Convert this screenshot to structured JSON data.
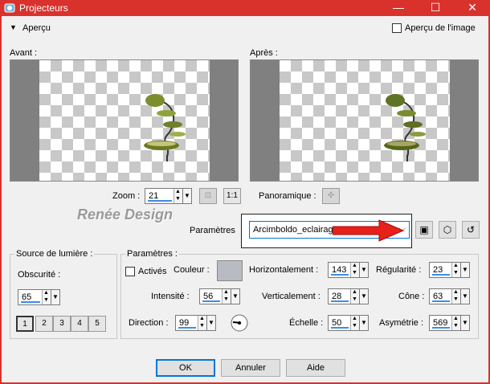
{
  "window": {
    "title": "Projecteurs",
    "minimize": "—",
    "maximize": "☐",
    "close": "✕"
  },
  "preview_header": {
    "toggle": "▼",
    "label": "Aperçu",
    "image_preview_label": "Aperçu de l'image"
  },
  "before": {
    "label": "Avant :"
  },
  "after": {
    "label": "Après :"
  },
  "zoom": {
    "label": "Zoom :",
    "value": "21"
  },
  "pan": {
    "label": "Panoramique :"
  },
  "watermark": "Renée Design",
  "presets": {
    "label": "Paramètres",
    "value": "Arcimboldo_eclairage"
  },
  "light_source": {
    "title": "Source de lumière :",
    "darkness_label": "Obscurité :",
    "darkness_value": "65",
    "light_buttons": [
      "1",
      "2",
      "3",
      "4",
      "5"
    ]
  },
  "params": {
    "title": "Paramètres :",
    "enabled_label": "Activés",
    "color_label": "Couleur :",
    "color": "#b8bcc2",
    "intensity_label": "Intensité :",
    "intensity_value": "56",
    "direction_label": "Direction :",
    "direction_value": "99",
    "horizontal_label": "Horizontalement :",
    "horizontal_value": "143",
    "vertical_label": "Verticalement :",
    "vertical_value": "28",
    "scale_label": "Échelle :",
    "scale_value": "50",
    "regularity_label": "Régularité :",
    "regularity_value": "23",
    "cone_label": "Cône :",
    "cone_value": "63",
    "asymmetry_label": "Asymétrie :",
    "asymmetry_value": "569"
  },
  "buttons": {
    "ok": "OK",
    "cancel": "Annuler",
    "help": "Aide"
  },
  "colors": {
    "titlebar": "#d9322d",
    "accent": "#0078d7",
    "arrow": "#e8201a"
  }
}
